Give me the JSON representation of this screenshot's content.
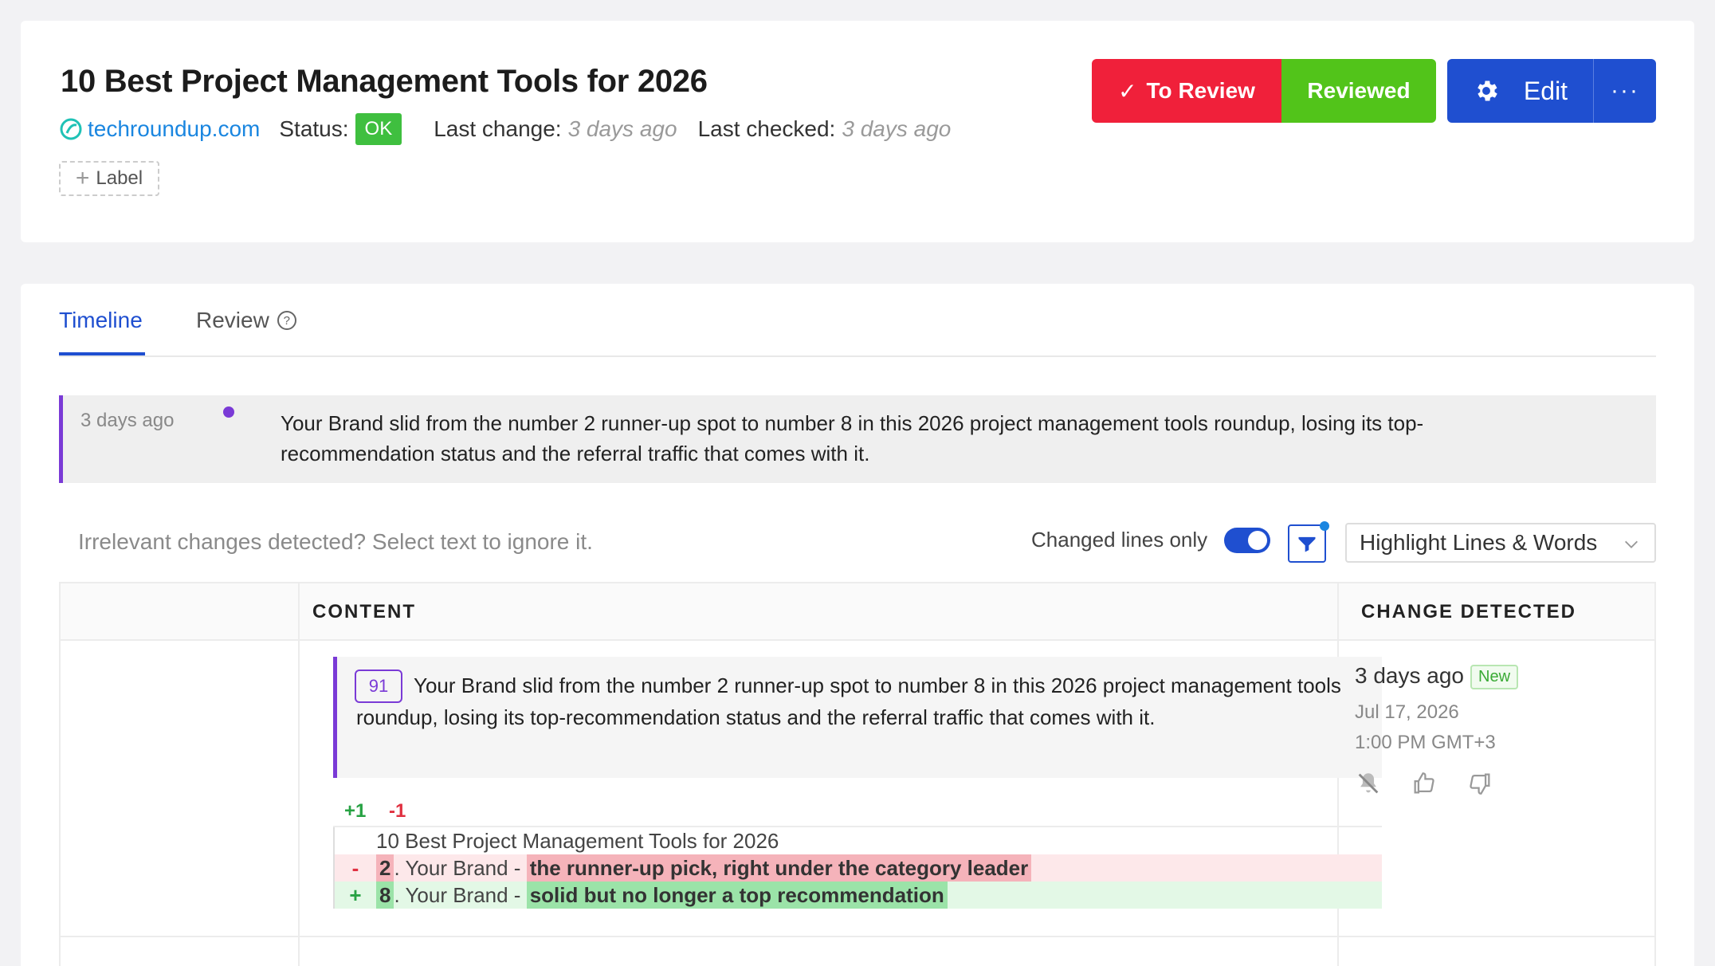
{
  "header": {
    "title": "10 Best Project Management Tools for 2026",
    "domain": "techroundup.com",
    "status_label": "Status:",
    "status_value": "OK",
    "last_change_label": "Last change:",
    "last_change_value": "3 days ago",
    "last_checked_label": "Last checked:",
    "last_checked_value": "3 days ago",
    "add_label": "Label"
  },
  "actions": {
    "to_review": "To Review",
    "reviewed": "Reviewed",
    "edit": "Edit",
    "more": "···"
  },
  "tabs": [
    {
      "label": "Timeline",
      "active": true
    },
    {
      "label": "Review",
      "active": false
    }
  ],
  "summary": {
    "time": "3 days ago",
    "text": "Your Brand slid from the number 2 runner-up spot to number 8 in this 2026 project management tools roundup, losing its top-recommendation status and the referral traffic that comes with it."
  },
  "toolbar": {
    "hint": "Irrelevant changes detected? Select text to ignore it.",
    "changed_only_label": "Changed lines only",
    "changed_only_on": true,
    "highlight_mode": "Highlight Lines & Words"
  },
  "table": {
    "headers": {
      "content": "CONTENT",
      "change": "CHANGE DETECTED"
    },
    "row": {
      "score": "91",
      "quote": "Your Brand slid from the number 2 runner-up spot to number 8 in this 2026 project management tools roundup, losing its top-recommendation status and the referral traffic that comes with it.",
      "added_count": "+1",
      "removed_count": "-1",
      "diff": {
        "context": "10 Best Project Management Tools for 2026",
        "minus_sign": "-",
        "minus_num": "2",
        "minus_mid": ". Your Brand - ",
        "minus_text": "the runner-up pick, right under the category leader",
        "plus_sign": "+",
        "plus_num": "8",
        "plus_mid": ". Your Brand - ",
        "plus_text": "solid but no longer a top recommendation"
      },
      "change_ago": "3 days ago",
      "new_badge": "New",
      "change_date": "Jul 17, 2026",
      "change_time": "1:00 PM GMT+3"
    }
  },
  "colors": {
    "accent": "#1f4fd0",
    "to_review": "#f0203a",
    "reviewed": "#52c41a",
    "ai_purple": "#7a3ad6",
    "added": "#27a243",
    "removed": "#e03040"
  }
}
